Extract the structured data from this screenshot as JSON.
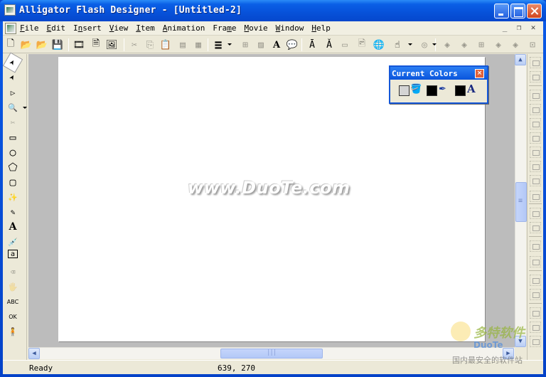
{
  "window": {
    "title": "Alligator Flash Designer - [Untitled-2]",
    "controls": {
      "minimize": "minimize",
      "maximize": "maximize",
      "close": "close"
    }
  },
  "menubar": {
    "items": [
      {
        "label": "File",
        "accel": "F",
        "rest": "ile"
      },
      {
        "label": "Edit",
        "accel": "E",
        "rest": "dit"
      },
      {
        "label": "Insert",
        "pre": "I",
        "accel": "n",
        "rest": "sert"
      },
      {
        "label": "View",
        "accel": "V",
        "rest": "iew"
      },
      {
        "label": "Item",
        "accel": "I",
        "rest": "tem"
      },
      {
        "label": "Animation",
        "accel": "A",
        "rest": "nimation"
      },
      {
        "label": "Frame",
        "pre": "Fra",
        "accel": "m",
        "rest": "e"
      },
      {
        "label": "Movie",
        "accel": "M",
        "rest": "ovie"
      },
      {
        "label": "Window",
        "accel": "W",
        "rest": "indow"
      },
      {
        "label": "Help",
        "accel": "H",
        "rest": "elp"
      }
    ],
    "mdi_controls": [
      "_",
      "❐",
      "✕"
    ]
  },
  "toolbar": {
    "buttons": [
      {
        "name": "new-icon",
        "glyph": "🗋",
        "enabled": true
      },
      {
        "name": "open-icon",
        "glyph": "📂",
        "enabled": true
      },
      {
        "name": "open-green-icon",
        "glyph": "📂",
        "enabled": true
      },
      {
        "name": "save-icon",
        "glyph": "💾",
        "enabled": true
      },
      {
        "name": "export-swf-icon",
        "glyph": "🎞",
        "enabled": true
      },
      {
        "name": "export-html-icon",
        "glyph": "🗎",
        "enabled": true
      },
      {
        "name": "preview-icon",
        "glyph": "🖼",
        "enabled": true
      },
      {
        "name": "cut-icon",
        "glyph": "✂",
        "enabled": false
      },
      {
        "name": "copy-icon",
        "glyph": "⎘",
        "enabled": false
      },
      {
        "name": "paste-icon",
        "glyph": "📋",
        "enabled": true
      },
      {
        "name": "paste-special-icon",
        "glyph": "▤",
        "enabled": false
      },
      {
        "name": "clone-icon",
        "glyph": "▦",
        "enabled": false
      },
      {
        "name": "line-width-icon",
        "glyph": "≡",
        "enabled": true
      },
      {
        "name": "grid-icon",
        "glyph": "⊞",
        "enabled": false
      },
      {
        "name": "fill-icon",
        "glyph": "▨",
        "enabled": false
      },
      {
        "name": "text-icon",
        "glyph": "A",
        "enabled": true
      },
      {
        "name": "comment-icon",
        "glyph": "💬",
        "enabled": true
      },
      {
        "name": "text-effect-up-icon",
        "glyph": "Ā",
        "enabled": true
      },
      {
        "name": "text-effect-down-icon",
        "glyph": "Ǎ",
        "enabled": true
      },
      {
        "name": "rectangle-fill-icon",
        "glyph": "▭",
        "enabled": false
      },
      {
        "name": "image-icon",
        "glyph": "🖻",
        "enabled": false
      },
      {
        "name": "web-globe-icon",
        "glyph": "🌐",
        "enabled": true
      },
      {
        "name": "hand-cursor-icon",
        "glyph": "☝",
        "enabled": true
      },
      {
        "name": "sound-icon",
        "glyph": "◎",
        "enabled": false
      },
      {
        "name": "frame-first-icon",
        "glyph": "◈",
        "enabled": false
      },
      {
        "name": "frame-prev-icon",
        "glyph": "◈",
        "enabled": false
      },
      {
        "name": "frame-grid-icon",
        "glyph": "⊞",
        "enabled": false
      },
      {
        "name": "frame-next-icon",
        "glyph": "◈",
        "enabled": false
      },
      {
        "name": "frame-last-icon",
        "glyph": "◈",
        "enabled": false
      },
      {
        "name": "frame-export-icon",
        "glyph": "⊡",
        "enabled": false
      }
    ]
  },
  "tools": [
    {
      "name": "select-arrow-icon",
      "glyph": "➤",
      "selected": true,
      "enabled": true
    },
    {
      "name": "subselect-arrow-icon",
      "glyph": "➤",
      "selected": false,
      "enabled": true
    },
    {
      "name": "hollow-arrow-icon",
      "glyph": "▷",
      "selected": false,
      "enabled": true
    },
    {
      "name": "zoom-icon",
      "glyph": "🔍",
      "selected": false,
      "enabled": true
    },
    {
      "name": "cut-shape-icon",
      "glyph": "✂",
      "selected": false,
      "enabled": false
    },
    {
      "name": "rectangle-icon",
      "glyph": "▭",
      "selected": false,
      "enabled": true
    },
    {
      "name": "ellipse-icon",
      "glyph": "○",
      "selected": false,
      "enabled": true
    },
    {
      "name": "polygon-icon",
      "glyph": "⬠",
      "selected": false,
      "enabled": true
    },
    {
      "name": "rounded-rect-icon",
      "glyph": "▢",
      "selected": false,
      "enabled": true
    },
    {
      "name": "magic-wand-icon",
      "glyph": "✨",
      "selected": false,
      "enabled": true
    },
    {
      "name": "pencil-icon",
      "glyph": "✎",
      "selected": false,
      "enabled": true
    },
    {
      "name": "text-tool-icon",
      "glyph": "A",
      "selected": false,
      "enabled": true
    },
    {
      "name": "eyedropper-icon",
      "glyph": "💉",
      "selected": false,
      "enabled": true
    },
    {
      "name": "edit-field-icon",
      "glyph": "a",
      "selected": false,
      "enabled": true
    },
    {
      "name": "eraser-icon",
      "glyph": "⌫",
      "selected": false,
      "enabled": false
    },
    {
      "name": "paint-bucket-icon",
      "glyph": "🖐",
      "selected": false,
      "enabled": false
    },
    {
      "name": "abc-text-icon",
      "glyph": "ABC",
      "selected": false,
      "enabled": true
    },
    {
      "name": "ok-button-icon",
      "glyph": "OK",
      "selected": false,
      "enabled": true
    },
    {
      "name": "sprite-icon",
      "glyph": "🧍",
      "selected": false,
      "enabled": true
    }
  ],
  "canvas": {
    "watermark": "www.DuoTe.com"
  },
  "colors_panel": {
    "title": "Current Colors",
    "close": "×",
    "fill_color": "#d4d4d4",
    "line_color": "#000000",
    "text_color": "#000000",
    "fill_icon": "🪣",
    "line_icon": "✒",
    "text_icon": "A"
  },
  "scrollbars": {
    "up": "▲",
    "down": "▼",
    "left": "◀",
    "right": "▶"
  },
  "status": {
    "text": "Ready",
    "coords": "639,  270"
  },
  "overlay_logo": {
    "cn": "多特软件",
    "en": "DuoTe",
    "sub": "国内最安全的软件站"
  }
}
